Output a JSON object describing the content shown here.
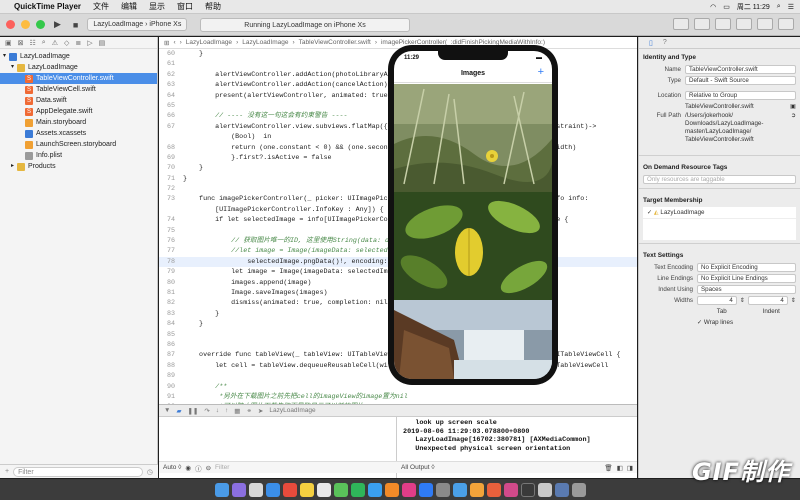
{
  "menubar": {
    "app": "QuickTime Player",
    "items": [
      "文件",
      "编辑",
      "显示",
      "窗口",
      "帮助"
    ],
    "clock": "周二 11:29"
  },
  "toolbar": {
    "scheme_project": "LazyLoadImage",
    "scheme_device": "iPhone Xs",
    "status": "Running LazyLoadImage on iPhone Xs"
  },
  "navigator": {
    "items": [
      {
        "label": "LazyLoadImage",
        "icon": "project-icon"
      },
      {
        "label": "LazyLoadImage",
        "icon": "folder-icon"
      },
      {
        "label": "TableViewController.swift",
        "icon": "swift-file-icon"
      },
      {
        "label": "TableViewCell.swift",
        "icon": "swift-file-icon"
      },
      {
        "label": "Data.swift",
        "icon": "swift-file-icon"
      },
      {
        "label": "AppDelegate.swift",
        "icon": "swift-file-icon"
      },
      {
        "label": "Main.storyboard",
        "icon": "storyboard-icon"
      },
      {
        "label": "Assets.xcassets",
        "icon": "assets-icon"
      },
      {
        "label": "LaunchScreen.storyboard",
        "icon": "storyboard-icon"
      },
      {
        "label": "Info.plist",
        "icon": "plist-icon"
      },
      {
        "label": "Products",
        "icon": "folder-icon"
      }
    ],
    "filter_placeholder": "Filter"
  },
  "editor": {
    "jumpbar": [
      "LazyLoadImage",
      "LazyLoadImage",
      "TableViewController.swift",
      "imagePickerController(_:didFinishPickingMediaWithInfo:)"
    ],
    "lines": [
      {
        "n": "60",
        "t": "    }"
      },
      {
        "n": "61",
        "t": ""
      },
      {
        "n": "62",
        "t": "        alertViewController.addAction(photoLibraryAction)"
      },
      {
        "n": "63",
        "t": "        alertViewController.addAction(cancelAction)"
      },
      {
        "n": "64",
        "t": "        present(alertViewController, animated: true"
      },
      {
        "n": "65",
        "t": ""
      },
      {
        "n": "66",
        "t": "        // ---- 没有这一句这会有约束警告 ----"
      },
      {
        "n": "67",
        "t": "        alertViewController.view.subviews.flatMap({$0.constraints}).filter{ (one: NSLayoutConstraint)->"
      },
      {
        "n": "",
        "t": "            (Bool)  in"
      },
      {
        "n": "68",
        "t": "            return (one.constant < 0) && (one.secondItem == nil) && (one.firstAttribute == .width)"
      },
      {
        "n": "69",
        "t": "            }.first?.isActive = false"
      },
      {
        "n": "70",
        "t": "    }"
      },
      {
        "n": "71",
        "t": "}"
      },
      {
        "n": "72",
        "t": ""
      },
      {
        "n": "73",
        "t": "    func imagePickerController(_ picker: UIImagePickerController, didFinishPickingMediaWithInfo info:"
      },
      {
        "n": "",
        "t": "        [UIImagePickerController.InfoKey : Any]) {"
      },
      {
        "n": "74",
        "t": "        if let selectedImage = info[UIImagePickerController.InfoKey.originalImage] as? UIImage {"
      },
      {
        "n": "75",
        "t": ""
      },
      {
        "n": "76",
        "t": "            // 获取图片唯一的ID, 这里使用String(data: data, encoding: .utf8)(不适用中文 Unicode)!"
      },
      {
        "n": "77",
        "t": "            //let image = Image(imageData: selectedImage.pngData()!, name:"
      },
      {
        "n": "78",
        "t": "                selectedImage.pngData()!, encoding: .utf8)!"
      },
      {
        "n": "79",
        "t": "            let image = Image(imageData: selectedImage.pngData()!)"
      },
      {
        "n": "80",
        "t": "            images.append(image)"
      },
      {
        "n": "81",
        "t": "            Image.saveImages(images)"
      },
      {
        "n": "82",
        "t": "            dismiss(animated: true, completion: nil)"
      },
      {
        "n": "83",
        "t": "        }"
      },
      {
        "n": "84",
        "t": "    }"
      },
      {
        "n": "85",
        "t": ""
      },
      {
        "n": "86",
        "t": ""
      },
      {
        "n": "87",
        "t": "    override func tableView(_ tableView: UITableView, cellForRowAt indexPath: IndexPath) -> UITableViewCell {"
      },
      {
        "n": "88",
        "t": "        let cell = tableView.dequeueReusableCell(withIdentifier: \"cell\", for: indexPath) as! TableViewCell"
      },
      {
        "n": "89",
        "t": ""
      },
      {
        "n": "90",
        "t": "        /**"
      },
      {
        "n": "91",
        "t": "         *另外在下载图片之前先把cell的imageView的image置为nil"
      },
      {
        "n": "92",
        "t": "         *可以防止图片下载失败而导致显示了以前的图片."
      }
    ]
  },
  "debugbar": {
    "target": "LazyLoadImage"
  },
  "console": {
    "lines": [
      "   look up screen scale",
      "2019-08-06 11:29:03.078800+0800",
      "   LazyLoadImage[16702:380781] [AXMediaCommon]",
      "   Unexpected physical screen orientation"
    ],
    "left_mode": "Auto ◊",
    "right_mode": "All Output ◊",
    "filter_placeholder": "Filter"
  },
  "inspector": {
    "identity_title": "Identity and Type",
    "name_label": "Name",
    "name_value": "TableViewController.swift",
    "type_label": "Type",
    "type_value": "Default - Swift Source",
    "location_label": "Location",
    "location_value": "Relative to Group",
    "location_file": "TableViewController.swift",
    "fullpath_label": "Full Path",
    "fullpath_value": "/Users/jokerhook/ Downloads/LazyLoadImage-master/LazyLoadImage/ TableViewController.swift",
    "odr_title": "On Demand Resource Tags",
    "odr_placeholder": "Only resources are taggable",
    "target_title": "Target Membership",
    "target_item": "LazyLoadImage",
    "text_title": "Text Settings",
    "encoding_label": "Text Encoding",
    "encoding_value": "No Explicit Encoding",
    "endings_label": "Line Endings",
    "endings_value": "No Explicit Line Endings",
    "indent_label": "Indent Using",
    "indent_value": "Spaces",
    "widths_label": "Widths",
    "tab_value": "4",
    "indent_num": "4",
    "tab_label": "Tab",
    "indent_sub": "Indent",
    "wrap_label": "Wrap lines"
  },
  "phone": {
    "time": "11:29",
    "title": "Images",
    "add": "+"
  },
  "watermark": "GIF制作"
}
